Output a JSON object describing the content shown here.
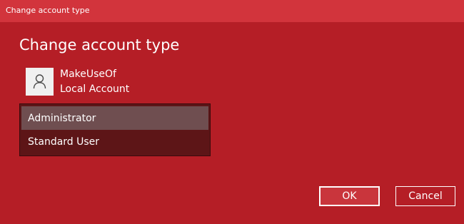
{
  "window": {
    "title": "Change account type"
  },
  "dialog": {
    "heading": "Change account type"
  },
  "account": {
    "avatar_icon": "user-icon",
    "name": "MakeUseOf",
    "type": "Local Account"
  },
  "account_type_select": {
    "selected": "Administrator",
    "options": [
      "Administrator",
      "Standard User"
    ]
  },
  "buttons": {
    "ok_label": "OK",
    "cancel_label": "Cancel"
  },
  "colors": {
    "accent": "#b51e26",
    "titlebar": "#d2343c",
    "dropdown_bg": "#5d1517",
    "selected_option": "#6f4e50"
  }
}
